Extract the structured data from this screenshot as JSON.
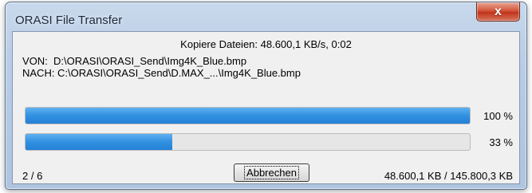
{
  "window": {
    "title": "ORASI File Transfer",
    "close_label": "x"
  },
  "status": {
    "text": "Kopiere Dateien: 48.600,1 KB/s, 0:02"
  },
  "paths": {
    "von": "VON:  D:\\ORASI\\ORASI_Send\\Img4K_Blue.bmp",
    "nach": "NACH: C:\\ORASI\\ORASI_Send\\D.MAX_...\\Img4K_Blue.bmp"
  },
  "progress": [
    {
      "value": 100,
      "label": "100 %"
    },
    {
      "value": 33,
      "label": "33 %"
    }
  ],
  "footer": {
    "count": "2 / 6",
    "cancel_label": "Abbrechen",
    "bytes": "48.600,1 KB / 145.800,3 KB"
  },
  "colors": {
    "progress_fill": "#3190e0",
    "close_button": "#c0351b"
  }
}
